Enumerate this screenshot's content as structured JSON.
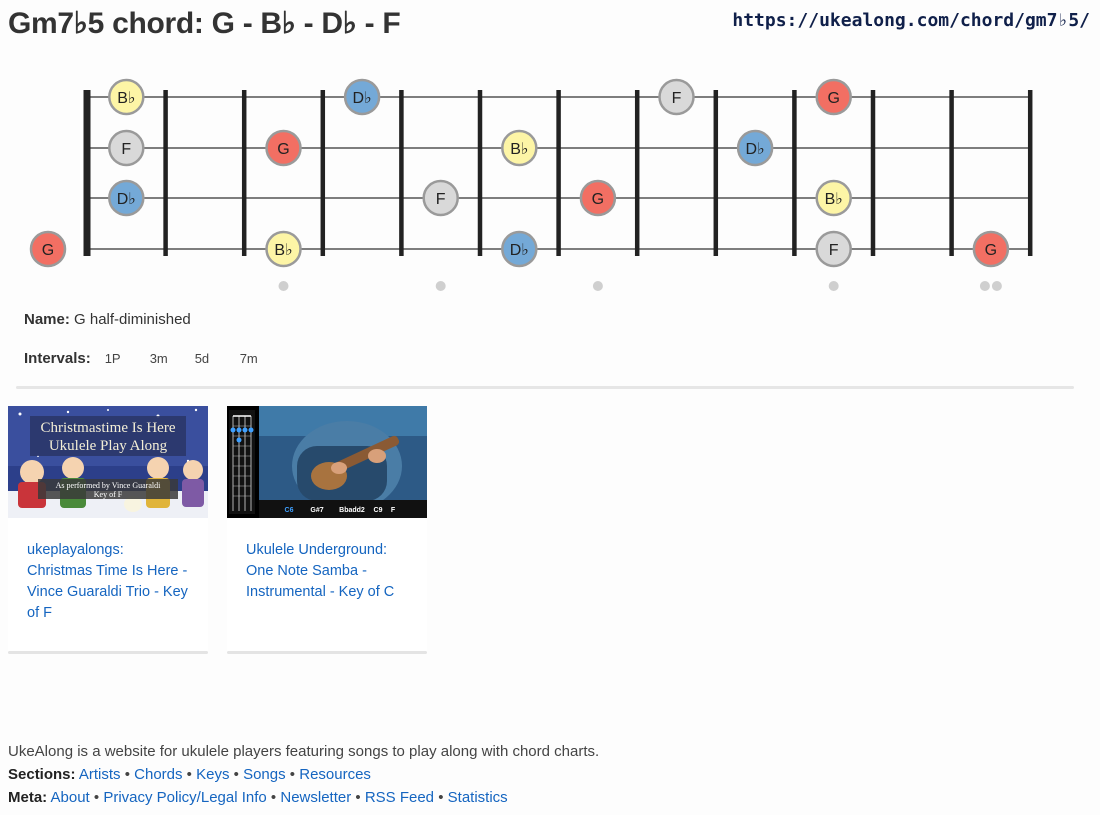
{
  "page": {
    "title": "Gm7♭5 chord: G - B♭ - D♭ - F",
    "url": "https://ukealong.com/chord/gm7♭5/"
  },
  "fretboard": {
    "strings": 4,
    "frets": 12,
    "fret_markers": [
      {
        "fret": 3,
        "count": 1
      },
      {
        "fret": 5,
        "count": 1
      },
      {
        "fret": 7,
        "count": 1
      },
      {
        "fret": 10,
        "count": 1
      },
      {
        "fret": 12,
        "count": 2
      }
    ],
    "note_colors": {
      "G": "#f26f63",
      "B♭": "#fdf5a6",
      "D♭": "#74a9d7",
      "F": "#d9d9d9"
    },
    "notes": [
      {
        "string": 1,
        "fret": 1,
        "label": "B♭"
      },
      {
        "string": 1,
        "fret": 4,
        "label": "D♭"
      },
      {
        "string": 1,
        "fret": 8,
        "label": "F"
      },
      {
        "string": 1,
        "fret": 10,
        "label": "G"
      },
      {
        "string": 2,
        "fret": 1,
        "label": "F"
      },
      {
        "string": 2,
        "fret": 3,
        "label": "G"
      },
      {
        "string": 2,
        "fret": 6,
        "label": "B♭"
      },
      {
        "string": 2,
        "fret": 9,
        "label": "D♭"
      },
      {
        "string": 3,
        "fret": 1,
        "label": "D♭"
      },
      {
        "string": 3,
        "fret": 5,
        "label": "F"
      },
      {
        "string": 3,
        "fret": 7,
        "label": "G"
      },
      {
        "string": 3,
        "fret": 10,
        "label": "B♭"
      },
      {
        "string": 4,
        "fret": 0,
        "label": "G"
      },
      {
        "string": 4,
        "fret": 3,
        "label": "B♭"
      },
      {
        "string": 4,
        "fret": 6,
        "label": "D♭"
      },
      {
        "string": 4,
        "fret": 10,
        "label": "F"
      },
      {
        "string": 4,
        "fret": 12,
        "label": "G"
      }
    ]
  },
  "info": {
    "name_label": "Name:",
    "name_value": "G half-diminished",
    "intervals_label": "Intervals:",
    "intervals": [
      "1P",
      "3m",
      "5d",
      "7m"
    ]
  },
  "videos": [
    {
      "title": "ukeplayalongs: Christmas Time Is Here - Vince Guaraldi Trio - Key of F",
      "thumb_line1": "Christmastime Is Here",
      "thumb_line2": "Ukulele Play Along",
      "thumb_line3": "As performed by Vince Guaraldi",
      "thumb_line4": "Key of F"
    },
    {
      "title": "Ukulele Underground: One Note Samba - Instrumental - Key of C",
      "thumb_chords": [
        "C6",
        "G#7",
        "Bbadd2",
        "C9",
        "F"
      ]
    }
  ],
  "footer": {
    "about_text": "UkeAlong is a website for ukulele players featuring songs to play along with chord charts.",
    "sections_label": "Sections:",
    "sections": [
      "Artists",
      "Chords",
      "Keys",
      "Songs",
      "Resources"
    ],
    "meta_label": "Meta:",
    "meta": [
      "About",
      "Privacy Policy/Legal Info",
      "Newsletter",
      "RSS Feed",
      "Statistics"
    ]
  }
}
